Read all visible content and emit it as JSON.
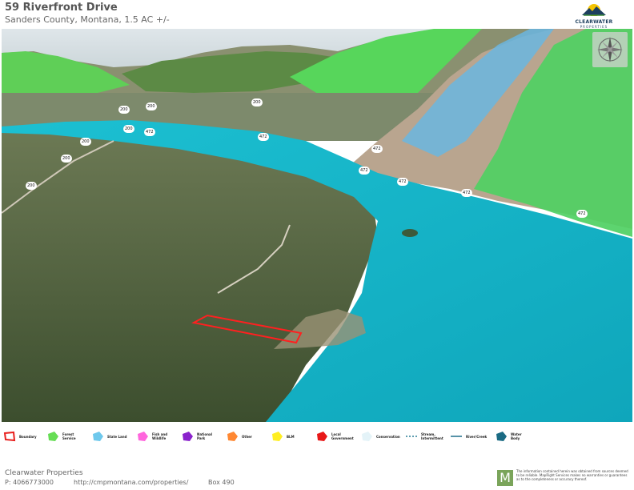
{
  "header": {
    "title": "59 Riverfront Drive",
    "subtitle": "Sanders County, Montana, 1.5 AC +/-"
  },
  "logo": {
    "brand": "CLEARWATER",
    "sub": "PROPERTIES"
  },
  "map": {
    "road_labels": [
      {
        "id": "472-a",
        "text": "472"
      },
      {
        "id": "472-b",
        "text": "472"
      },
      {
        "id": "472-c",
        "text": "472"
      },
      {
        "id": "472-d",
        "text": "472"
      },
      {
        "id": "472-e",
        "text": "472"
      },
      {
        "id": "472-f",
        "text": "472"
      },
      {
        "id": "472-g",
        "text": "472"
      },
      {
        "id": "200-a",
        "text": "200"
      },
      {
        "id": "200-b",
        "text": "200"
      },
      {
        "id": "200-c",
        "text": "200"
      },
      {
        "id": "200-d",
        "text": "200"
      },
      {
        "id": "200-e",
        "text": "200"
      },
      {
        "id": "200-f",
        "text": "200"
      },
      {
        "id": "200-g",
        "text": "200"
      }
    ],
    "compass_icon": "compass-rose-icon",
    "colors": {
      "water": "#18b6c9",
      "forest_service": "#5fd35a",
      "state_land": "#6ab6e0",
      "boundary": "#ff2020"
    }
  },
  "legend": [
    {
      "label": "Boundary",
      "color": "#e8201e",
      "shape": "boundary-outline"
    },
    {
      "label": "Forest Service",
      "color": "#66dd55",
      "shape": "polygon"
    },
    {
      "label": "State Land",
      "color": "#6ec8ec",
      "shape": "polygon"
    },
    {
      "label": "Fish and Wildlife",
      "color": "#ff66dd",
      "shape": "polygon"
    },
    {
      "label": "National Park",
      "color": "#8a22cc",
      "shape": "polygon"
    },
    {
      "label": "Other",
      "color": "#ff8833",
      "shape": "polygon"
    },
    {
      "label": "BLM",
      "color": "#ffee22",
      "shape": "polygon"
    },
    {
      "label": "Local Government",
      "color": "#e81818",
      "shape": "polygon"
    },
    {
      "label": "Conservation",
      "color": "#e4f3f8",
      "shape": "polygon"
    },
    {
      "label": "Stream, Intermittent",
      "color": "#2a7f95",
      "shape": "dashed-line"
    },
    {
      "label": "River/Creek",
      "color": "#1f6f8b",
      "shape": "line"
    },
    {
      "label": "Water Body",
      "color": "#1b6b84",
      "shape": "polygon"
    }
  ],
  "footer": {
    "company": "Clearwater Properties",
    "phone": "P: 4066773000",
    "url": "http://cmpmontana.com/properties/",
    "box": "Box 490",
    "mapright_letter": "M",
    "disclaimer": "The information contained herein was obtained from sources deemed to be reliable. MapRight Services makes no warranties or guarantees as to the completeness or accuracy thereof."
  }
}
